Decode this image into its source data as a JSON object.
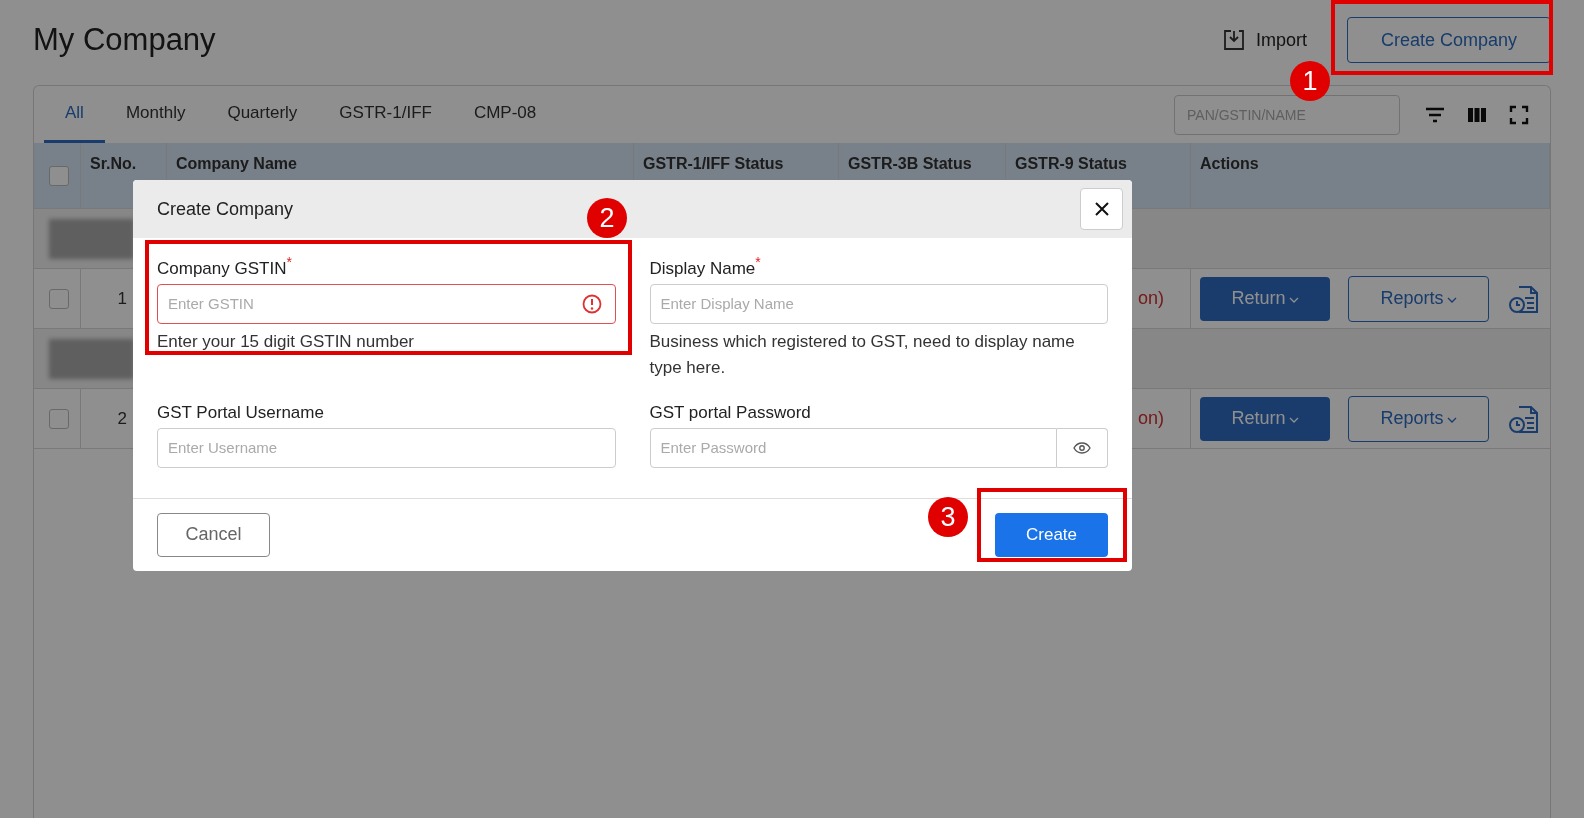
{
  "page": {
    "title": "My Company",
    "import_label": "Import",
    "create_button": "Create Company"
  },
  "tabs": [
    {
      "label": "All",
      "selected": true
    },
    {
      "label": "Monthly",
      "selected": false
    },
    {
      "label": "Quarterly",
      "selected": false
    },
    {
      "label": "GSTR-1/IFF",
      "selected": false
    },
    {
      "label": "CMP-08",
      "selected": false
    }
  ],
  "search": {
    "placeholder": "PAN/GSTIN/NAME"
  },
  "table": {
    "select_all_checked": false,
    "columns": [
      "Sr.No.",
      "Company Name",
      "GSTR-1/IFF Status",
      "GSTR-3B Status",
      "GSTR-9 Status",
      "Actions"
    ],
    "rows": [
      {
        "kind": "group"
      },
      {
        "kind": "company",
        "checked": false,
        "sr": "1",
        "status": "on)",
        "return": "Return",
        "reports": "Reports"
      },
      {
        "kind": "group"
      },
      {
        "kind": "company",
        "checked": false,
        "sr": "2",
        "status": "on)",
        "return": "Return",
        "reports": "Reports"
      }
    ]
  },
  "dialog": {
    "title": "Create Company",
    "required_mark": "*",
    "fields": [
      {
        "kind": "text",
        "label": "Company GSTIN",
        "required": true,
        "error": true,
        "placeholder": "Enter GSTIN",
        "helper": "Enter your 15 digit GSTIN number"
      },
      {
        "kind": "text",
        "label": "Display Name",
        "required": true,
        "error": false,
        "placeholder": "Enter Display Name",
        "helper": "Business which registered to GST, need to display name type here."
      },
      {
        "kind": "text",
        "label": "GST Portal Username",
        "required": false,
        "error": false,
        "placeholder": "Enter Username"
      },
      {
        "kind": "password",
        "label": "GST portal Password",
        "required": false,
        "error": false,
        "placeholder": "Enter Password"
      }
    ],
    "cancel": "Cancel",
    "create": "Create"
  },
  "annotations": [
    {
      "number": "1"
    },
    {
      "number": "2"
    },
    {
      "number": "3"
    }
  ]
}
